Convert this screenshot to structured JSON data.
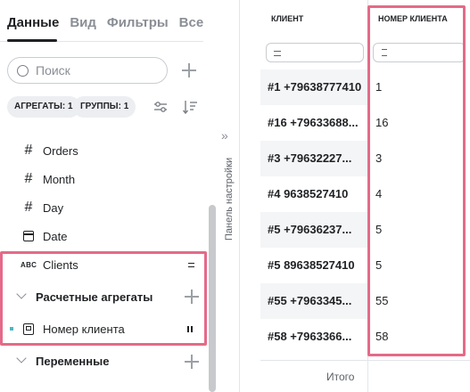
{
  "tabs": [
    {
      "label": "Данные",
      "active": true
    },
    {
      "label": "Вид",
      "active": false
    },
    {
      "label": "Фильтры",
      "active": false
    },
    {
      "label": "Все",
      "active": false
    }
  ],
  "search": {
    "placeholder": "Поиск"
  },
  "chips": {
    "aggregates": "АГРЕГАТЫ: 1",
    "groups": "ГРУППЫ: 1"
  },
  "fields": [
    {
      "type": "number",
      "type_glyph": "#",
      "label": "Orders"
    },
    {
      "type": "number",
      "type_glyph": "#",
      "label": "Month"
    },
    {
      "type": "number",
      "type_glyph": "#",
      "label": "Day"
    },
    {
      "type": "date",
      "type_glyph": "calendar-icon",
      "label": "Date"
    },
    {
      "type": "string",
      "type_glyph": "ABC",
      "label": "Clients"
    }
  ],
  "sections": {
    "calculated": {
      "title": "Расчетные агрегаты",
      "items": [
        {
          "label": "Номер клиента"
        }
      ]
    },
    "variables": {
      "title": "Переменные"
    }
  },
  "settings_panel": {
    "label": "Панель настройки",
    "collapse_glyph": "»"
  },
  "table": {
    "columns": [
      "КЛИЕНТ",
      "НОМЕР КЛИЕНТА"
    ],
    "rows": [
      {
        "client": "#1 +79638777410",
        "number": "1"
      },
      {
        "client": "#16 +79633688...",
        "number": "16"
      },
      {
        "client": "#3 +79632227...",
        "number": "3"
      },
      {
        "client": "#4 9638527410",
        "number": "4"
      },
      {
        "client": "#5 +79636237...",
        "number": "5"
      },
      {
        "client": "#5 89638527410",
        "number": "5"
      },
      {
        "client": "#55 +7963345...",
        "number": "55"
      },
      {
        "client": "#58 +7963366...",
        "number": "58"
      }
    ],
    "totals_label": "Итого"
  },
  "colors": {
    "highlight": "#e46a88",
    "accent_dot": "#4fb6c4"
  }
}
